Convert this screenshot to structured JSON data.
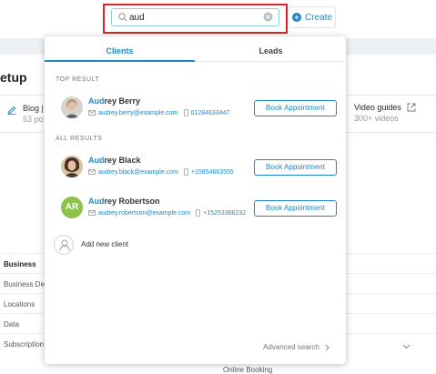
{
  "search": {
    "value": "aud",
    "placeholder": ""
  },
  "create_button": {
    "label": "Create"
  },
  "background": {
    "heading": "etup",
    "blog": {
      "title": "Blog |",
      "subtitle": "53 po"
    },
    "video": {
      "title": "Video guides",
      "subtitle": "300+ videos"
    },
    "side_items": [
      "Business",
      "Business Det",
      "Locations",
      "Data",
      "Subscription"
    ],
    "online_booking": "Online Booking"
  },
  "dropdown": {
    "tabs": [
      {
        "label": "Clients",
        "active": true
      },
      {
        "label": "Leads",
        "active": false
      }
    ],
    "top_result_label": "TOP RESULT",
    "all_results_label": "ALL RESULTS",
    "top_result": {
      "name_match": "Aud",
      "name_rest": "rey Berry",
      "email": "audrey.berry@example.com",
      "phone": "01284633447",
      "button": "Book Appointment"
    },
    "all_results": [
      {
        "name_match": "Aud",
        "name_rest": "rey Black",
        "email": "audrey.black@example.com",
        "phone": "+15854663555",
        "button": "Book Appointment"
      },
      {
        "name_match": "Aud",
        "name_rest": "rey Robertson",
        "email": "audrey.robertson@example.com",
        "phone": "+15253366232",
        "button": "Book Appointment",
        "initials": "AR"
      }
    ],
    "add_client": "Add new client",
    "advanced_search": "Advanced search"
  },
  "colors": {
    "accent": "#1e88c6",
    "highlight_border": "#d9252d",
    "avatar_green": "#8bc34a"
  }
}
